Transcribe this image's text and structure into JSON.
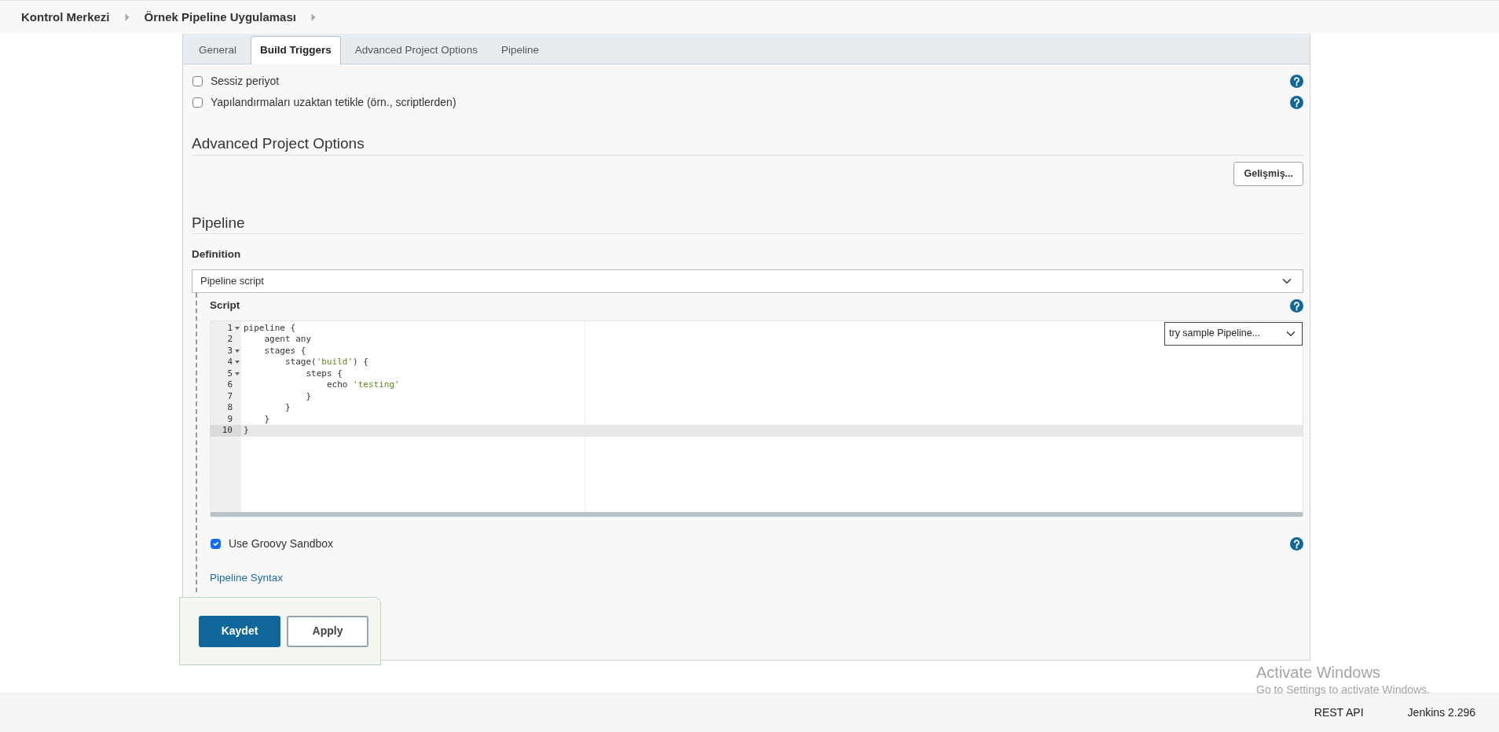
{
  "breadcrumbs": [
    {
      "label": "Kontrol Merkezi"
    },
    {
      "label": "Örnek Pipeline Uygulaması"
    }
  ],
  "tabs": [
    {
      "label": "General",
      "selected": false
    },
    {
      "label": "Build Triggers",
      "selected": true
    },
    {
      "label": "Advanced Project Options",
      "selected": false
    },
    {
      "label": "Pipeline",
      "selected": false
    }
  ],
  "triggers": [
    {
      "label": "Sessiz periyot",
      "checked": false
    },
    {
      "label": "Yapılandırmaları uzaktan tetikle (örn., scriptlerden)",
      "checked": false
    }
  ],
  "advanced": {
    "title": "Advanced Project Options",
    "button": "Gelişmiş..."
  },
  "pipeline": {
    "title": "Pipeline",
    "definition_label": "Definition",
    "definition_value": "Pipeline script",
    "script_label": "Script",
    "sample_select": "try sample Pipeline...",
    "code_lines": [
      {
        "number": "1",
        "foldable": true,
        "current": false,
        "parts": [
          {
            "text": "pipeline {",
            "kind": "plain"
          }
        ]
      },
      {
        "number": "2",
        "foldable": false,
        "current": false,
        "parts": [
          {
            "text": "    agent any",
            "kind": "plain"
          }
        ]
      },
      {
        "number": "3",
        "foldable": true,
        "current": false,
        "parts": [
          {
            "text": "    stages {",
            "kind": "plain"
          }
        ]
      },
      {
        "number": "4",
        "foldable": true,
        "current": false,
        "parts": [
          {
            "text": "        stage(",
            "kind": "plain"
          },
          {
            "text": "'build'",
            "kind": "string"
          },
          {
            "text": ") {",
            "kind": "plain"
          }
        ]
      },
      {
        "number": "5",
        "foldable": true,
        "current": false,
        "parts": [
          {
            "text": "            steps {",
            "kind": "plain"
          }
        ]
      },
      {
        "number": "6",
        "foldable": false,
        "current": false,
        "parts": [
          {
            "text": "                echo ",
            "kind": "plain"
          },
          {
            "text": "'testing'",
            "kind": "string"
          }
        ]
      },
      {
        "number": "7",
        "foldable": false,
        "current": false,
        "parts": [
          {
            "text": "            }",
            "kind": "plain"
          }
        ]
      },
      {
        "number": "8",
        "foldable": false,
        "current": false,
        "parts": [
          {
            "text": "        }",
            "kind": "plain"
          }
        ]
      },
      {
        "number": "9",
        "foldable": false,
        "current": false,
        "parts": [
          {
            "text": "    }",
            "kind": "plain"
          }
        ]
      },
      {
        "number": "10",
        "foldable": false,
        "current": true,
        "parts": [
          {
            "text": "}",
            "kind": "plain"
          }
        ]
      }
    ],
    "sandbox": {
      "label": "Use Groovy Sandbox",
      "checked": true
    },
    "syntax_link": "Pipeline Syntax"
  },
  "actions": [
    {
      "label": "Kaydet",
      "kind": "primary"
    },
    {
      "label": "Apply",
      "kind": "secondary"
    }
  ],
  "footer": {
    "links": [
      "REST API",
      "Jenkins 2.296"
    ]
  },
  "os_notice": {
    "title": "Activate Windows",
    "text": "Go to Settings to activate Windows."
  }
}
